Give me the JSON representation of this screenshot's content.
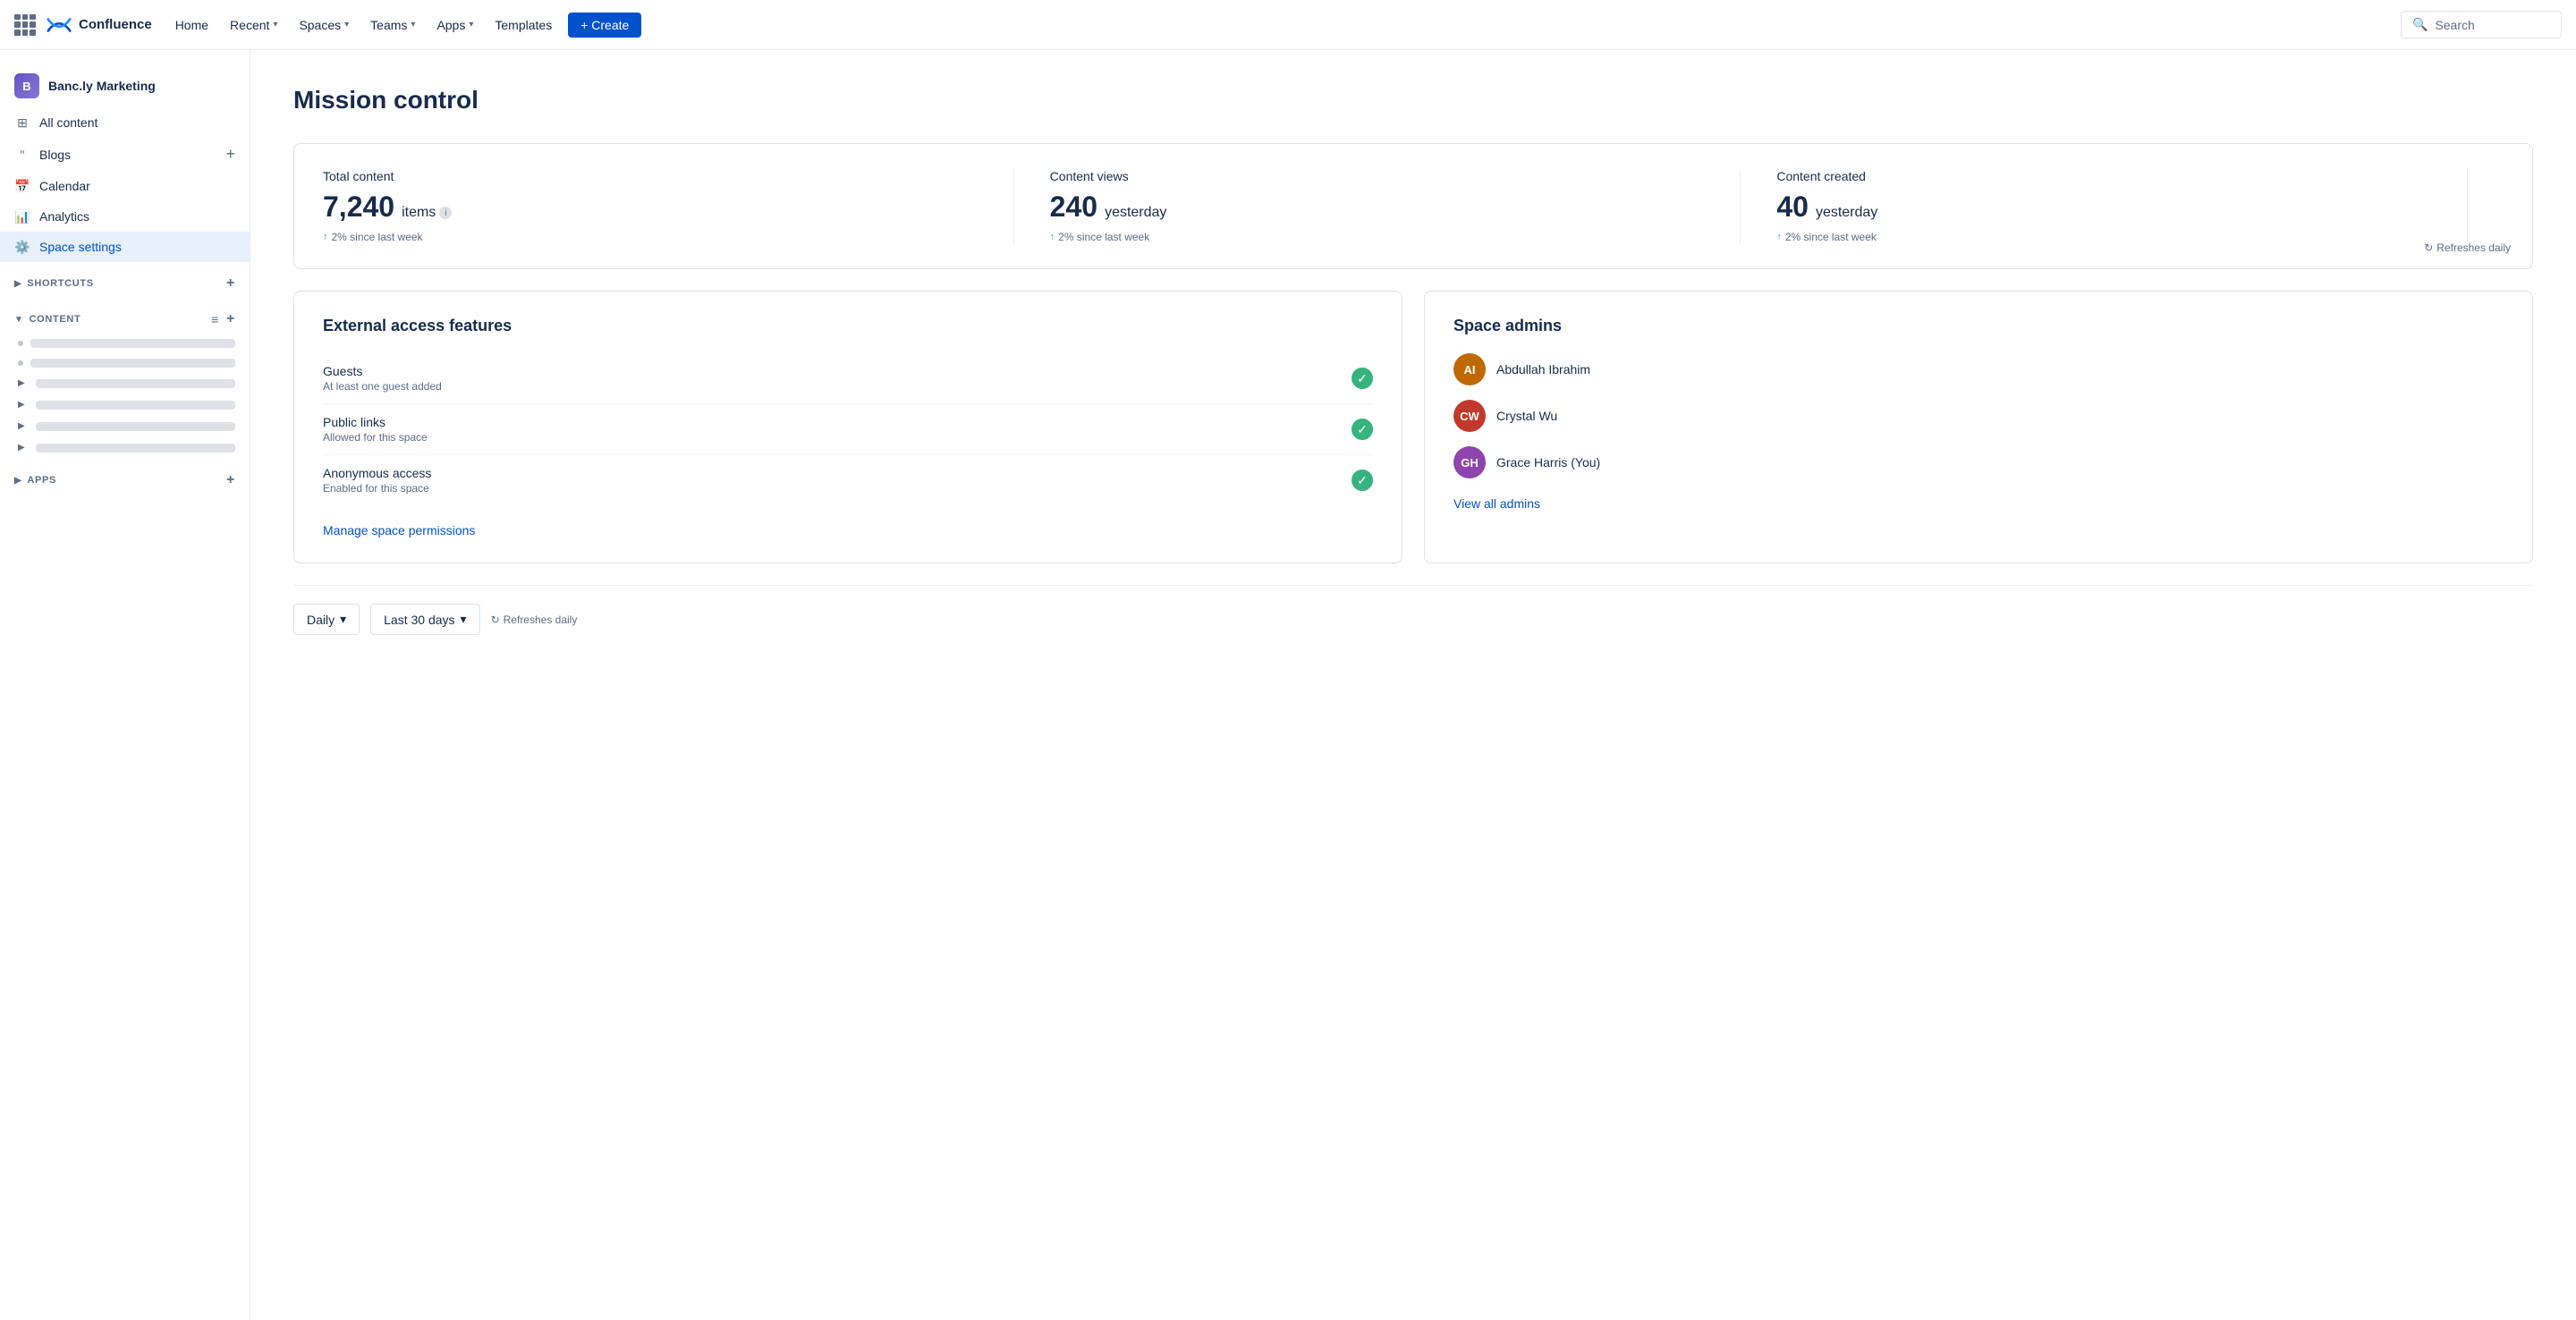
{
  "topnav": {
    "logo_text": "Confluence",
    "home": "Home",
    "recent": "Recent",
    "spaces": "Spaces",
    "teams": "Teams",
    "apps": "Apps",
    "templates": "Templates",
    "create": "+ Create",
    "search_placeholder": "Search"
  },
  "sidebar": {
    "space_name": "Banc.ly Marketing",
    "all_content": "All content",
    "blogs": "Blogs",
    "calendar": "Calendar",
    "analytics": "Analytics",
    "space_settings": "Space settings",
    "shortcuts_section": "SHORTCUTS",
    "content_section": "CONTENT",
    "apps_section": "APPS"
  },
  "main": {
    "page_title": "Mission control",
    "stats": {
      "total_content_label": "Total content",
      "total_content_value": "7,240",
      "total_content_unit": "items",
      "total_content_change": "2% since last week",
      "content_views_label": "Content views",
      "content_views_value": "240",
      "content_views_unit": "yesterday",
      "content_views_change": "2% since last week",
      "content_created_label": "Content created",
      "content_created_value": "40",
      "content_created_unit": "yesterday",
      "content_created_change": "2% since last week",
      "refreshes_daily": "Refreshes daily"
    },
    "external_access": {
      "title": "External access features",
      "features": [
        {
          "name": "Guests",
          "desc": "At least one guest added"
        },
        {
          "name": "Public links",
          "desc": "Allowed for this space"
        },
        {
          "name": "Anonymous access",
          "desc": "Enabled for this space"
        }
      ],
      "manage_link": "Manage space permissions"
    },
    "space_admins": {
      "title": "Space admins",
      "admins": [
        {
          "name": "Abdullah Ibrahim",
          "color": "#bf6900"
        },
        {
          "name": "Crystal Wu",
          "color": "#c0392b"
        },
        {
          "name": "Grace Harris (You)",
          "color": "#8e44ad"
        }
      ],
      "view_all": "View all admins"
    },
    "bottom": {
      "daily_label": "Daily",
      "last30_label": "Last 30 days",
      "refreshes_daily": "Refreshes daily"
    }
  }
}
